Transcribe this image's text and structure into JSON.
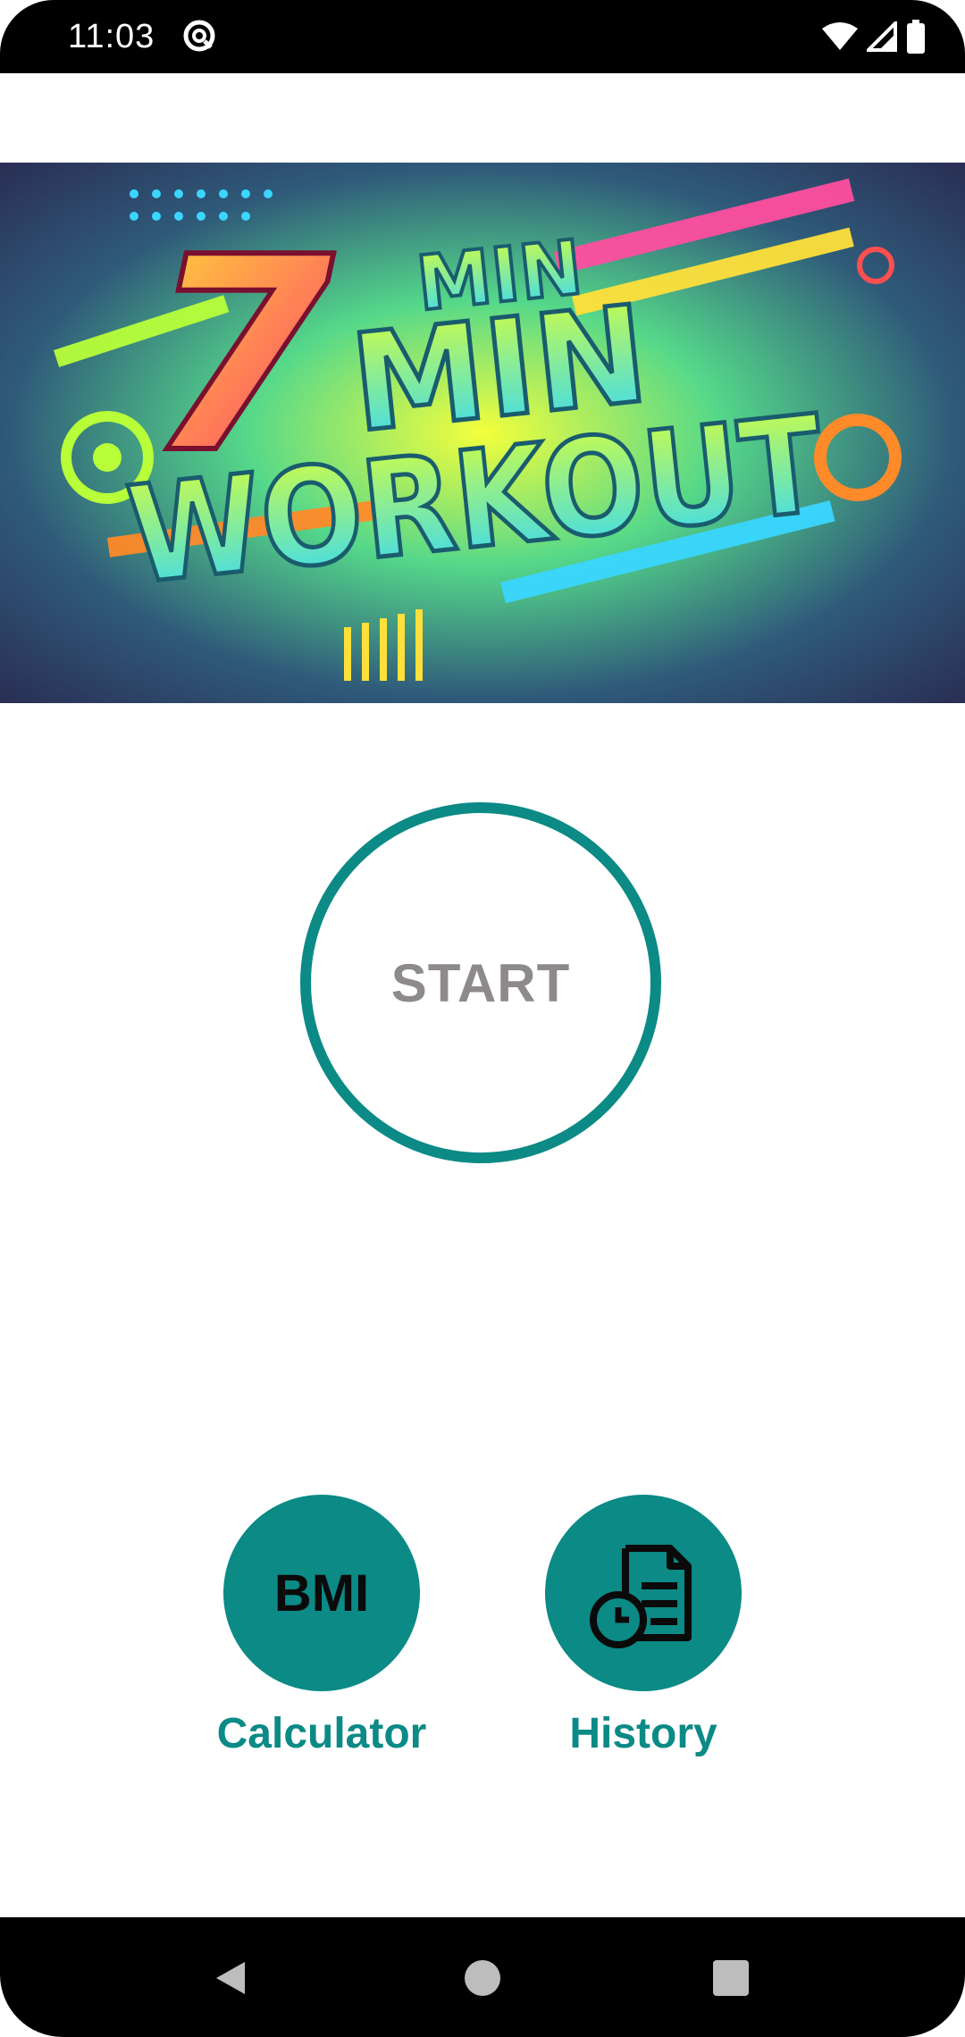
{
  "status_bar": {
    "time": "11:03"
  },
  "banner": {
    "line1": "7",
    "line1b": "MIN",
    "line2": "MIN",
    "line3": "WORKOUT"
  },
  "start": {
    "label": "START"
  },
  "actions": {
    "bmi": {
      "icon_text": "BMI",
      "label": "Calculator"
    },
    "history": {
      "label": "History"
    }
  },
  "colors": {
    "accent": "#0b8a86",
    "start_text": "#8e8a8a"
  }
}
